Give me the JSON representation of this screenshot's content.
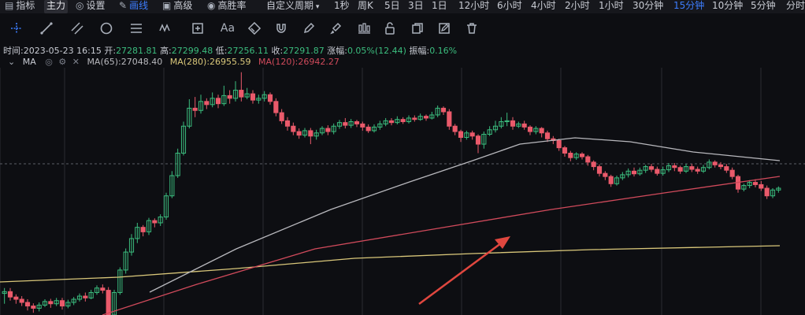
{
  "colors": {
    "up": "#3bbd7e",
    "down": "#ea5a6b",
    "accent": "#3d7eff",
    "ma65": "#b8b8bd",
    "ma120": "#d04a5b",
    "ma280": "#d9c77a",
    "arrow": "#e0473f",
    "grid": "#2a2c33"
  },
  "topbar": {
    "items": [
      {
        "label": "指标",
        "icon": "chart-icon"
      },
      {
        "label": "主力",
        "badge": true
      },
      {
        "label": "设置",
        "icon": "gear-icon"
      },
      {
        "label": "画线",
        "icon": "pen-icon",
        "active": true
      },
      {
        "label": "高级",
        "icon": "briefcase-icon"
      },
      {
        "label": "高胜率",
        "icon": "target-icon"
      },
      {
        "label": "自定义周期",
        "icon": "caret-down-icon"
      },
      {
        "label": "1秒"
      },
      {
        "label": "周K"
      },
      {
        "label": "5日"
      },
      {
        "label": "3日"
      },
      {
        "label": "1日"
      },
      {
        "label": "12小时"
      },
      {
        "label": "6小时"
      },
      {
        "label": "4小时"
      },
      {
        "label": "2小时"
      },
      {
        "label": "1小时"
      },
      {
        "label": "30分钟"
      },
      {
        "label": "15分钟",
        "active": true
      },
      {
        "label": "10分钟"
      },
      {
        "label": "5分钟"
      },
      {
        "label": "分时"
      }
    ]
  },
  "toolbar": {
    "tools": [
      "crosshair-icon",
      "trendline-icon",
      "parallel-channel-icon",
      "circle-icon",
      "horizontal-lines-icon",
      "wave-pattern-icon",
      "measure-box-icon",
      "text-tool-icon",
      "eraser-icon",
      "magnet-icon",
      "pencil-icon",
      "brush-icon",
      "candles-icon",
      "lock-icon",
      "copy-icon",
      "edit-icon",
      "trash-icon"
    ],
    "text_tool_label": "Aa",
    "wave_label": "W"
  },
  "info": {
    "time_label": "时间:",
    "time": "2023-05-23 16:15",
    "open_label": "开:",
    "open": "27281.81",
    "high_label": "高:",
    "high": "27299.48",
    "low_label": "低:",
    "low": "27256.11",
    "close_label": "收:",
    "close": "27291.87",
    "change_label": "涨幅:",
    "change": "0.05%(12.44)",
    "amplitude_label": "振幅:",
    "amplitude": "0.16%"
  },
  "ma": {
    "label": "MA",
    "ma65": "MA(65):27048.40",
    "ma280": "MA(280):26955.59",
    "ma120": "MA(120):26942.27"
  },
  "chart_data": {
    "type": "candlestick",
    "interval": "15分钟",
    "ylim": [
      26780,
      27330
    ],
    "lines": [
      "MA(65)",
      "MA(120)",
      "MA(280)"
    ],
    "candles": [
      [
        26828,
        26832,
        26805,
        26840
      ],
      [
        26832,
        26820,
        26812,
        26840
      ],
      [
        26820,
        26815,
        26805,
        26826
      ],
      [
        26815,
        26808,
        26800,
        26822
      ],
      [
        26808,
        26800,
        26790,
        26815
      ],
      [
        26800,
        26795,
        26785,
        26806
      ],
      [
        26795,
        26802,
        26788,
        26808
      ],
      [
        26802,
        26810,
        26798,
        26815
      ],
      [
        26810,
        26805,
        26796,
        26816
      ],
      [
        26805,
        26812,
        26800,
        26818
      ],
      [
        26812,
        26800,
        26792,
        26818
      ],
      [
        26800,
        26808,
        26795,
        26814
      ],
      [
        26808,
        26815,
        26802,
        26820
      ],
      [
        26815,
        26822,
        26810,
        26828
      ],
      [
        26822,
        26818,
        26810,
        26830
      ],
      [
        26818,
        26830,
        26815,
        26836
      ],
      [
        26830,
        26840,
        26825,
        26846
      ],
      [
        26840,
        26835,
        26828,
        26848
      ],
      [
        26835,
        26780,
        26770,
        26842
      ],
      [
        26780,
        26830,
        26775,
        26836
      ],
      [
        26830,
        26880,
        26825,
        26886
      ],
      [
        26880,
        26920,
        26872,
        26928
      ],
      [
        26920,
        26950,
        26912,
        26960
      ],
      [
        26950,
        26975,
        26940,
        26985
      ],
      [
        26975,
        26965,
        26955,
        26980
      ],
      [
        26965,
        26990,
        26958,
        26996
      ],
      [
        26990,
        26985,
        26975,
        26995
      ],
      [
        26985,
        26998,
        26978,
        27004
      ],
      [
        26998,
        27045,
        26992,
        27052
      ],
      [
        27045,
        27090,
        27040,
        27100
      ],
      [
        27090,
        27140,
        27085,
        27150
      ],
      [
        27140,
        27200,
        27135,
        27210
      ],
      [
        27200,
        27240,
        27195,
        27260
      ],
      [
        27240,
        27235,
        27220,
        27265
      ],
      [
        27235,
        27255,
        27228,
        27270
      ],
      [
        27255,
        27248,
        27238,
        27262
      ],
      [
        27248,
        27262,
        27242,
        27275
      ],
      [
        27262,
        27250,
        27240,
        27270
      ],
      [
        27250,
        27268,
        27245,
        27290
      ],
      [
        27268,
        27262,
        27250,
        27280
      ],
      [
        27262,
        27280,
        27255,
        27300
      ],
      [
        27280,
        27265,
        27255,
        27320
      ],
      [
        27265,
        27272,
        27260,
        27285
      ],
      [
        27272,
        27258,
        27250,
        27280
      ],
      [
        27258,
        27262,
        27250,
        27270
      ],
      [
        27262,
        27270,
        27255,
        27278
      ],
      [
        27270,
        27255,
        27248,
        27275
      ],
      [
        27255,
        27230,
        27222,
        27262
      ],
      [
        27230,
        27212,
        27205,
        27238
      ],
      [
        27212,
        27200,
        27190,
        27220
      ],
      [
        27200,
        27188,
        27180,
        27208
      ],
      [
        27188,
        27180,
        27172,
        27195
      ],
      [
        27180,
        27190,
        27175,
        27196
      ],
      [
        27190,
        27178,
        27160,
        27196
      ],
      [
        27178,
        27185,
        27170,
        27192
      ],
      [
        27185,
        27195,
        27180,
        27200
      ],
      [
        27195,
        27188,
        27180,
        27202
      ],
      [
        27188,
        27200,
        27182,
        27206
      ],
      [
        27200,
        27208,
        27194,
        27214
      ],
      [
        27208,
        27202,
        27195,
        27218
      ],
      [
        27202,
        27210,
        27196,
        27216
      ],
      [
        27210,
        27205,
        27198,
        27214
      ],
      [
        27205,
        27198,
        27190,
        27210
      ],
      [
        27198,
        27190,
        27185,
        27204
      ],
      [
        27190,
        27198,
        27186,
        27204
      ],
      [
        27198,
        27205,
        27192,
        27212
      ],
      [
        27205,
        27212,
        27200,
        27218
      ],
      [
        27212,
        27208,
        27202,
        27218
      ],
      [
        27208,
        27215,
        27204,
        27222
      ],
      [
        27215,
        27210,
        27205,
        27220
      ],
      [
        27210,
        27218,
        27206,
        27224
      ],
      [
        27218,
        27215,
        27210,
        27224
      ],
      [
        27215,
        27222,
        27212,
        27228
      ],
      [
        27222,
        27218,
        27212,
        27226
      ],
      [
        27218,
        27225,
        27215,
        27232
      ],
      [
        27225,
        27240,
        27220,
        27246
      ],
      [
        27240,
        27232,
        27225,
        27244
      ],
      [
        27232,
        27200,
        27192,
        27238
      ],
      [
        27200,
        27188,
        27180,
        27205
      ],
      [
        27188,
        27175,
        27165,
        27192
      ],
      [
        27175,
        27185,
        27170,
        27190
      ],
      [
        27185,
        27178,
        27170,
        27190
      ],
      [
        27178,
        27160,
        27140,
        27182
      ],
      [
        27160,
        27182,
        27150,
        27188
      ],
      [
        27182,
        27192,
        27178,
        27200
      ],
      [
        27192,
        27200,
        27186,
        27212
      ],
      [
        27200,
        27210,
        27195,
        27220
      ],
      [
        27210,
        27212,
        27200,
        27230
      ],
      [
        27212,
        27200,
        27192,
        27220
      ],
      [
        27200,
        27205,
        27196,
        27210
      ],
      [
        27205,
        27198,
        27192,
        27212
      ],
      [
        27198,
        27188,
        27180,
        27202
      ],
      [
        27188,
        27195,
        27182,
        27200
      ],
      [
        27195,
        27185,
        27175,
        27198
      ],
      [
        27185,
        27172,
        27165,
        27190
      ],
      [
        27172,
        27168,
        27160,
        27178
      ],
      [
        27168,
        27152,
        27145,
        27172
      ],
      [
        27152,
        27140,
        27132,
        27156
      ],
      [
        27140,
        27130,
        27122,
        27145
      ],
      [
        27130,
        27138,
        27125,
        27142
      ],
      [
        27138,
        27132,
        27126,
        27142
      ],
      [
        27132,
        27120,
        27112,
        27136
      ],
      [
        27120,
        27110,
        27102,
        27124
      ],
      [
        27110,
        27095,
        27088,
        27115
      ],
      [
        27095,
        27088,
        27080,
        27100
      ],
      [
        27088,
        27072,
        27065,
        27092
      ],
      [
        27072,
        27085,
        27068,
        27090
      ],
      [
        27085,
        27092,
        27080,
        27098
      ],
      [
        27092,
        27100,
        27086,
        27106
      ],
      [
        27100,
        27094,
        27088,
        27108
      ],
      [
        27094,
        27102,
        27090,
        27108
      ],
      [
        27102,
        27110,
        27096,
        27114
      ],
      [
        27110,
        27104,
        27098,
        27116
      ],
      [
        27104,
        27095,
        27090,
        27110
      ],
      [
        27095,
        27103,
        27090,
        27110
      ],
      [
        27103,
        27112,
        27098,
        27118
      ],
      [
        27112,
        27108,
        27100,
        27118
      ],
      [
        27108,
        27100,
        27094,
        27112
      ],
      [
        27100,
        27110,
        27096,
        27116
      ],
      [
        27110,
        27104,
        27098,
        27116
      ],
      [
        27104,
        27100,
        27094,
        27110
      ],
      [
        27100,
        27108,
        27096,
        27114
      ],
      [
        27108,
        27120,
        27104,
        27126
      ],
      [
        27120,
        27114,
        27108,
        27124
      ],
      [
        27114,
        27110,
        27104,
        27120
      ],
      [
        27110,
        27102,
        27096,
        27116
      ],
      [
        27102,
        27088,
        27082,
        27108
      ],
      [
        27088,
        27060,
        27052,
        27092
      ],
      [
        27060,
        27068,
        27055,
        27072
      ],
      [
        27068,
        27075,
        27062,
        27080
      ],
      [
        27075,
        27070,
        27064,
        27082
      ],
      [
        27070,
        27062,
        27056,
        27078
      ],
      [
        27062,
        27045,
        27038,
        27068
      ],
      [
        27045,
        27058,
        27040,
        27062
      ],
      [
        27058,
        27062,
        27052,
        27066
      ]
    ]
  }
}
